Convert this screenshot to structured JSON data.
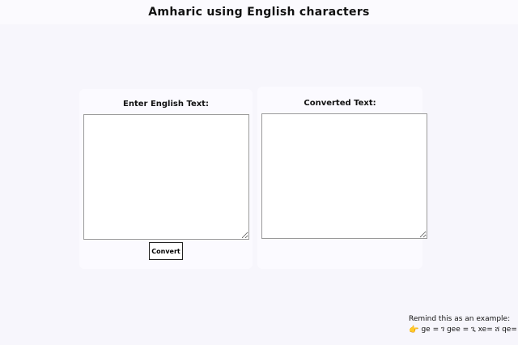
{
  "header": {
    "title": "Amharic using English characters"
  },
  "input_panel": {
    "title": "Enter English Text:",
    "textarea_value": "",
    "button_label": "Convert"
  },
  "output_panel": {
    "title": "Converted Text:",
    "textarea_value": ""
  },
  "example": {
    "heading": "Remind this as an example:",
    "icon": "pointing-hand-icon",
    "text": "ge = ገ gee = ጊ xe= ሸ qe= ቀ"
  }
}
